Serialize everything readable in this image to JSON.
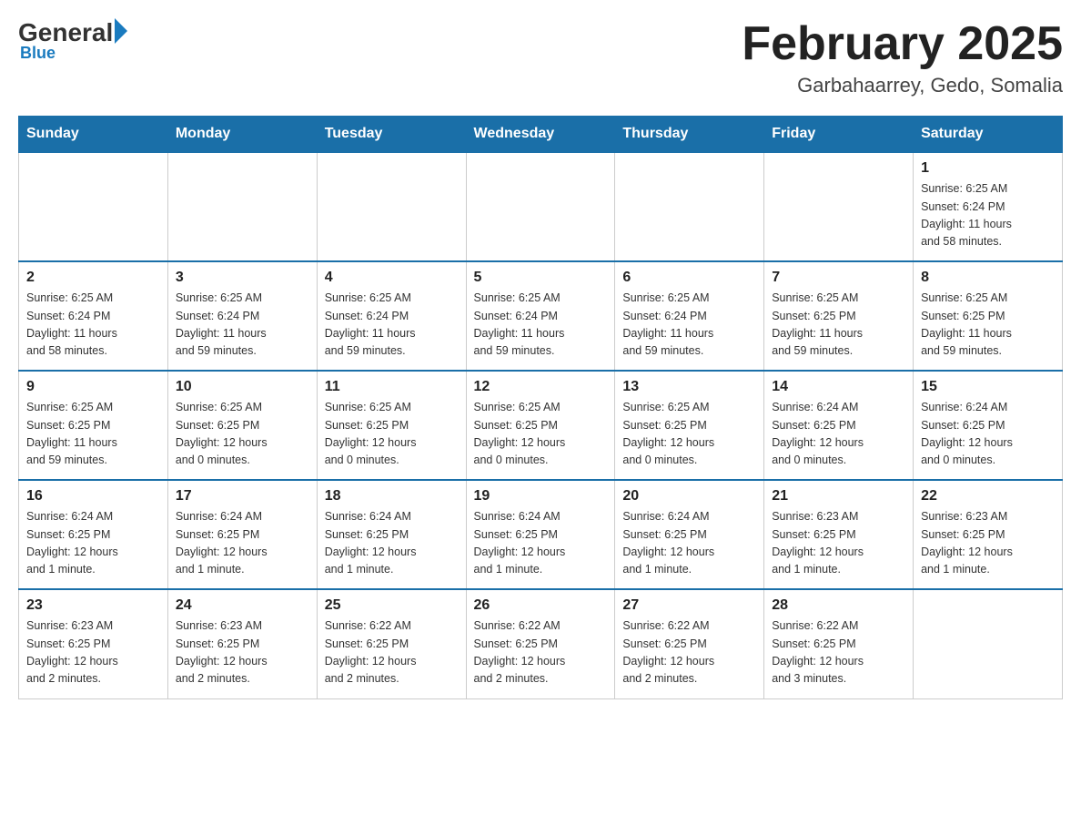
{
  "header": {
    "logo_general": "General",
    "logo_blue": "Blue",
    "month_year": "February 2025",
    "location": "Garbahaarrey, Gedo, Somalia"
  },
  "weekdays": [
    "Sunday",
    "Monday",
    "Tuesday",
    "Wednesday",
    "Thursday",
    "Friday",
    "Saturday"
  ],
  "weeks": [
    [
      {
        "day": "",
        "info": ""
      },
      {
        "day": "",
        "info": ""
      },
      {
        "day": "",
        "info": ""
      },
      {
        "day": "",
        "info": ""
      },
      {
        "day": "",
        "info": ""
      },
      {
        "day": "",
        "info": ""
      },
      {
        "day": "1",
        "info": "Sunrise: 6:25 AM\nSunset: 6:24 PM\nDaylight: 11 hours\nand 58 minutes."
      }
    ],
    [
      {
        "day": "2",
        "info": "Sunrise: 6:25 AM\nSunset: 6:24 PM\nDaylight: 11 hours\nand 58 minutes."
      },
      {
        "day": "3",
        "info": "Sunrise: 6:25 AM\nSunset: 6:24 PM\nDaylight: 11 hours\nand 59 minutes."
      },
      {
        "day": "4",
        "info": "Sunrise: 6:25 AM\nSunset: 6:24 PM\nDaylight: 11 hours\nand 59 minutes."
      },
      {
        "day": "5",
        "info": "Sunrise: 6:25 AM\nSunset: 6:24 PM\nDaylight: 11 hours\nand 59 minutes."
      },
      {
        "day": "6",
        "info": "Sunrise: 6:25 AM\nSunset: 6:24 PM\nDaylight: 11 hours\nand 59 minutes."
      },
      {
        "day": "7",
        "info": "Sunrise: 6:25 AM\nSunset: 6:25 PM\nDaylight: 11 hours\nand 59 minutes."
      },
      {
        "day": "8",
        "info": "Sunrise: 6:25 AM\nSunset: 6:25 PM\nDaylight: 11 hours\nand 59 minutes."
      }
    ],
    [
      {
        "day": "9",
        "info": "Sunrise: 6:25 AM\nSunset: 6:25 PM\nDaylight: 11 hours\nand 59 minutes."
      },
      {
        "day": "10",
        "info": "Sunrise: 6:25 AM\nSunset: 6:25 PM\nDaylight: 12 hours\nand 0 minutes."
      },
      {
        "day": "11",
        "info": "Sunrise: 6:25 AM\nSunset: 6:25 PM\nDaylight: 12 hours\nand 0 minutes."
      },
      {
        "day": "12",
        "info": "Sunrise: 6:25 AM\nSunset: 6:25 PM\nDaylight: 12 hours\nand 0 minutes."
      },
      {
        "day": "13",
        "info": "Sunrise: 6:25 AM\nSunset: 6:25 PM\nDaylight: 12 hours\nand 0 minutes."
      },
      {
        "day": "14",
        "info": "Sunrise: 6:24 AM\nSunset: 6:25 PM\nDaylight: 12 hours\nand 0 minutes."
      },
      {
        "day": "15",
        "info": "Sunrise: 6:24 AM\nSunset: 6:25 PM\nDaylight: 12 hours\nand 0 minutes."
      }
    ],
    [
      {
        "day": "16",
        "info": "Sunrise: 6:24 AM\nSunset: 6:25 PM\nDaylight: 12 hours\nand 1 minute."
      },
      {
        "day": "17",
        "info": "Sunrise: 6:24 AM\nSunset: 6:25 PM\nDaylight: 12 hours\nand 1 minute."
      },
      {
        "day": "18",
        "info": "Sunrise: 6:24 AM\nSunset: 6:25 PM\nDaylight: 12 hours\nand 1 minute."
      },
      {
        "day": "19",
        "info": "Sunrise: 6:24 AM\nSunset: 6:25 PM\nDaylight: 12 hours\nand 1 minute."
      },
      {
        "day": "20",
        "info": "Sunrise: 6:24 AM\nSunset: 6:25 PM\nDaylight: 12 hours\nand 1 minute."
      },
      {
        "day": "21",
        "info": "Sunrise: 6:23 AM\nSunset: 6:25 PM\nDaylight: 12 hours\nand 1 minute."
      },
      {
        "day": "22",
        "info": "Sunrise: 6:23 AM\nSunset: 6:25 PM\nDaylight: 12 hours\nand 1 minute."
      }
    ],
    [
      {
        "day": "23",
        "info": "Sunrise: 6:23 AM\nSunset: 6:25 PM\nDaylight: 12 hours\nand 2 minutes."
      },
      {
        "day": "24",
        "info": "Sunrise: 6:23 AM\nSunset: 6:25 PM\nDaylight: 12 hours\nand 2 minutes."
      },
      {
        "day": "25",
        "info": "Sunrise: 6:22 AM\nSunset: 6:25 PM\nDaylight: 12 hours\nand 2 minutes."
      },
      {
        "day": "26",
        "info": "Sunrise: 6:22 AM\nSunset: 6:25 PM\nDaylight: 12 hours\nand 2 minutes."
      },
      {
        "day": "27",
        "info": "Sunrise: 6:22 AM\nSunset: 6:25 PM\nDaylight: 12 hours\nand 2 minutes."
      },
      {
        "day": "28",
        "info": "Sunrise: 6:22 AM\nSunset: 6:25 PM\nDaylight: 12 hours\nand 3 minutes."
      },
      {
        "day": "",
        "info": ""
      }
    ]
  ]
}
